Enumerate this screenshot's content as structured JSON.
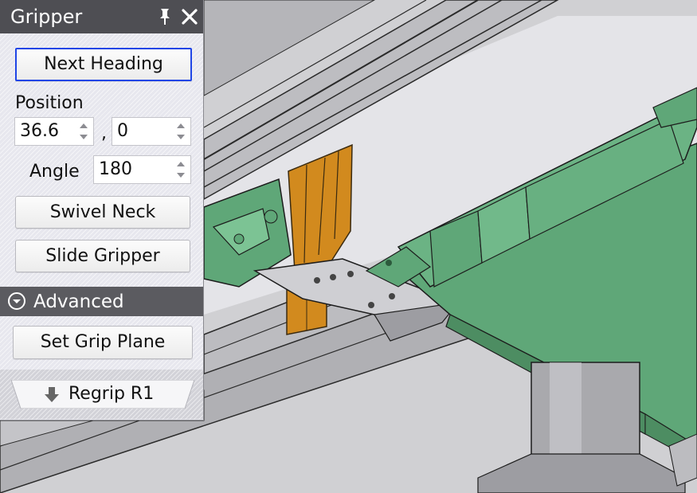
{
  "panel": {
    "title": "Gripper",
    "pin_icon": "pin-icon",
    "close_icon": "close-icon",
    "next_heading_label": "Next Heading",
    "position_label": "Position",
    "position_x": "36.6",
    "position_separator": ",",
    "position_y": "0",
    "angle_label": "Angle",
    "angle_value": "180",
    "swivel_neck_label": "Swivel Neck",
    "slide_gripper_label": "Slide Gripper",
    "advanced_label": "Advanced",
    "advanced_icon": "chevron-down-circle-icon",
    "set_grip_plane_label": "Set Grip Plane",
    "regrip_label": "Regrip R1",
    "regrip_icon": "arrow-down-icon"
  },
  "colors": {
    "title_bar": "#4e4e53",
    "section_bar": "#5b5b60",
    "focus_border": "#1f45e6",
    "part_green": "#5fa778",
    "part_orange": "#d28a1e",
    "part_metal": "#c8c8cc"
  }
}
